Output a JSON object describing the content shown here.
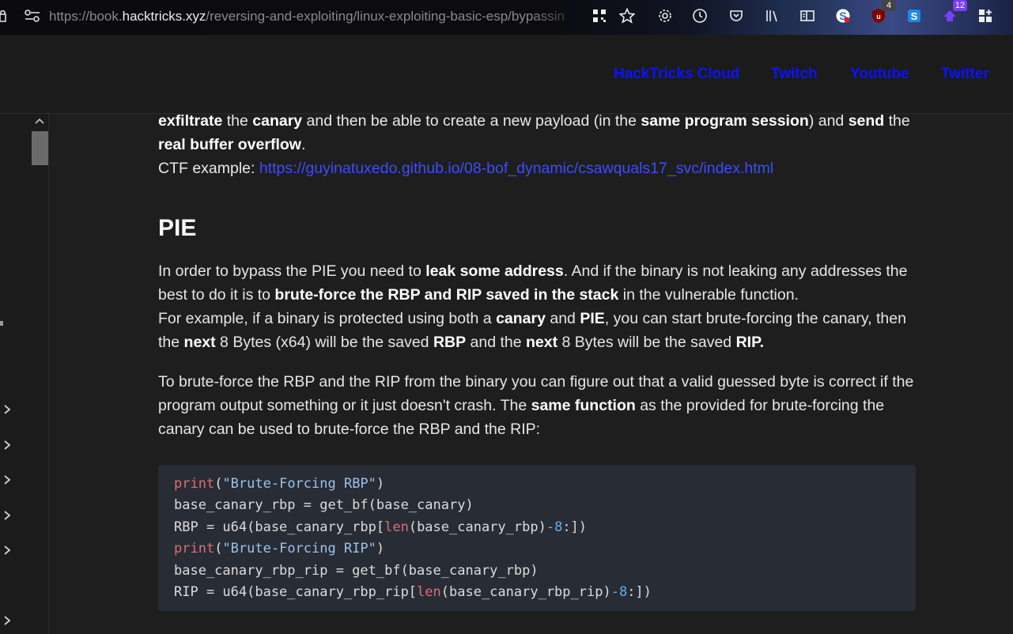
{
  "browser": {
    "url_prefix": "https://book.",
    "url_host": "hacktricks.xyz",
    "url_path": "/reversing-and-exploiting/linux-exploiting-basic-esp/bypassin",
    "badges": {
      "ublock": "4",
      "extension": "12"
    }
  },
  "header": {
    "nav": [
      "HackTricks Cloud",
      "Twitch",
      "Youtube",
      "Twitter"
    ]
  },
  "intro": {
    "line1": {
      "b1": "exfiltrate",
      "t1": " the ",
      "b2": "canary",
      "t2": " and then be able to create a new payload (in the ",
      "b3": "same program session",
      "t3": ") and ",
      "b4": "send",
      "t4": " the"
    },
    "line2": {
      "b1": "real buffer overflow",
      "t1": "."
    },
    "ctf_label": "CTF example: ",
    "ctf_link": "https://guyinatuxedo.github.io/08-bof_dynamic/csawquals17_svc/index.html"
  },
  "section_title": "PIE",
  "para1": {
    "s1": "In order to bypass the PIE you need to ",
    "b1": "leak some address",
    "s2": ". And if the binary is not leaking any addresses the best to do it is to ",
    "b2": "brute-force the RBP and RIP saved in the stack",
    "s3": " in the vulnerable function.",
    "s4": "For example, if a binary is protected using both a ",
    "b3": "canary",
    "s5": " and ",
    "b4": "PIE",
    "s6": ", you can start brute-forcing the canary, then the ",
    "b5": "next",
    "s7": " 8 Bytes (x64) will be the saved ",
    "b6": "RBP",
    "s8": " and the ",
    "b7": "next",
    "s9": " 8 Bytes will be the saved ",
    "b8": "RIP."
  },
  "para2": {
    "s1": "To brute-force the RBP and the RIP from the binary you can figure out that a valid guessed byte is correct if the program output something or it just doesn't crash. The ",
    "b1": "same function",
    "s2": " as the provided for brute-forcing the canary can be used to brute-force the RBP and the RIP:"
  },
  "code": {
    "l1": {
      "kw": "print",
      "open": "(",
      "str": "\"Brute-Forcing RBP\"",
      "close": ")"
    },
    "l2": "base_canary_rbp = get_bf(base_canary)",
    "l3": {
      "a": "RBP = u64(base_canary_rbp[",
      "kw": "len",
      "b": "(base_canary_rbp)",
      "num": "-8",
      "c": ":])"
    },
    "l4": {
      "kw": "print",
      "open": "(",
      "str": "\"Brute-Forcing RIP\"",
      "close": ")"
    },
    "l5": "base_canary_rbp_rip = get_bf(base_canary_rbp)",
    "l6": {
      "a": "RIP = u64(base_canary_rbp_rip[",
      "kw": "len",
      "b": "(base_canary_rbp_rip)",
      "num": "-8",
      "c": ":])"
    }
  }
}
